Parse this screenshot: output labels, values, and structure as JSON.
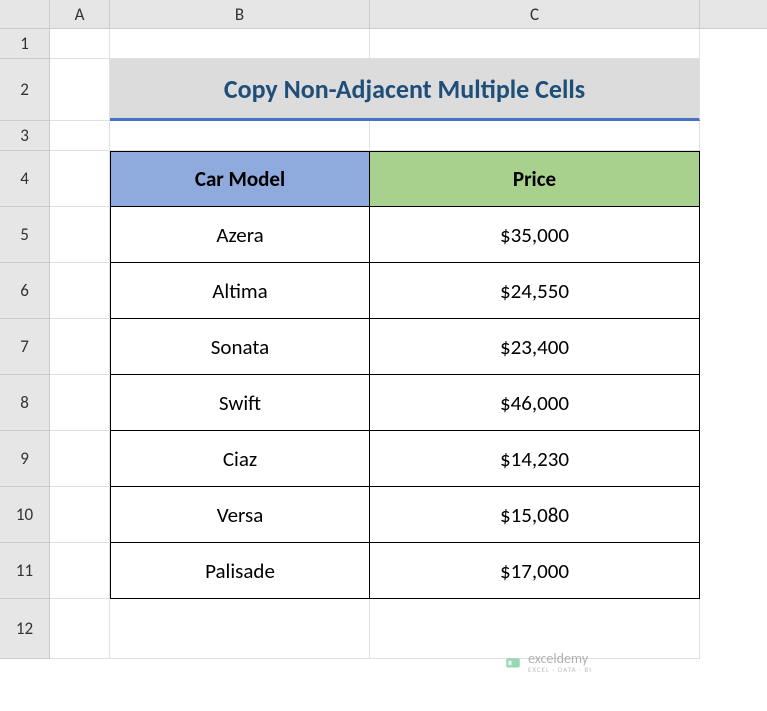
{
  "columns": {
    "A": "A",
    "B": "B",
    "C": "C"
  },
  "rows": {
    "r1": "1",
    "r2": "2",
    "r3": "3",
    "r4": "4",
    "r5": "5",
    "r6": "6",
    "r7": "7",
    "r8": "8",
    "r9": "9",
    "r10": "10",
    "r11": "11",
    "r12": "12"
  },
  "title": "Copy Non-Adjacent Multiple Cells",
  "headers": {
    "model": "Car Model",
    "price": "Price"
  },
  "data": [
    {
      "model": "Azera",
      "price": "$35,000"
    },
    {
      "model": "Altima",
      "price": "$24,550"
    },
    {
      "model": "Sonata",
      "price": "$23,400"
    },
    {
      "model": "Swift",
      "price": "$46,000"
    },
    {
      "model": "Ciaz",
      "price": "$14,230"
    },
    {
      "model": "Versa",
      "price": "$15,080"
    },
    {
      "model": "Palisade",
      "price": "$17,000"
    }
  ],
  "watermark": {
    "name": "exceldemy",
    "sub": "EXCEL · DATA · BI"
  }
}
